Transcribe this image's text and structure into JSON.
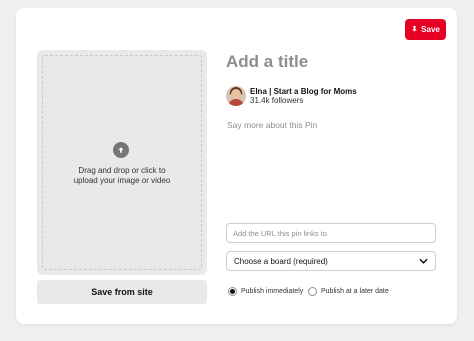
{
  "header": {
    "save_label": "Save"
  },
  "upload": {
    "icon": "upload-arrow-icon",
    "line1": "Drag and drop or click to",
    "line2": "upload your image or video",
    "save_from_site_label": "Save from site"
  },
  "pin": {
    "title_placeholder": "Add a title",
    "author_name": "Elna | Start a Blog for Moms",
    "author_followers": "31.4k followers",
    "description_placeholder": "Say more about this Pin",
    "url_placeholder": "Add the URL this pin links to",
    "board_placeholder": "Choose a board (required)"
  },
  "publish": {
    "options": [
      {
        "label": "Publish immediately",
        "checked": true
      },
      {
        "label": "Publish at a later date",
        "checked": false
      }
    ]
  },
  "colors": {
    "accent": "#e60023",
    "background": "#efefef",
    "upload_bg": "#e9e9e9"
  }
}
